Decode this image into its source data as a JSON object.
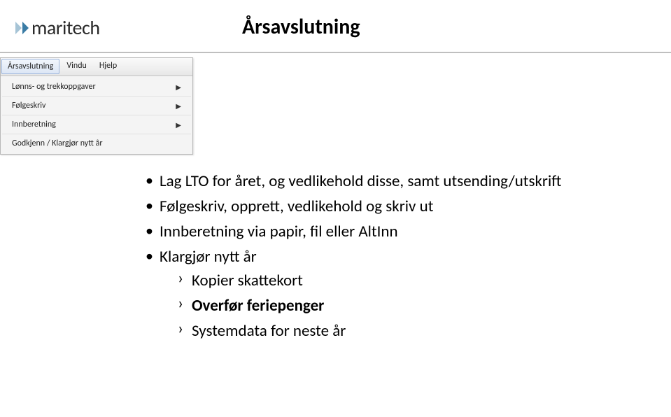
{
  "logo_text": "maritech",
  "page_title": "Årsavslutning",
  "menubar": {
    "items": [
      {
        "label": "Årsavslutning"
      },
      {
        "label": "Vindu"
      },
      {
        "label": "Hjelp"
      }
    ]
  },
  "dropdown": {
    "items": [
      {
        "label": "Lønns- og trekkoppgaver",
        "has_submenu": true
      },
      {
        "label": "Følgeskriv",
        "has_submenu": true
      },
      {
        "label": "Innberetning",
        "has_submenu": true
      },
      {
        "label": "Godkjenn / Klargjør nytt år",
        "has_submenu": false
      }
    ]
  },
  "bullets": {
    "b1": "Lag LTO for året, og vedlikehold disse, samt utsending/utskrift",
    "b2": "Følgeskriv, opprett, vedlikehold og skriv ut",
    "b3": "Innberetning via papir, fil eller AltInn",
    "b4": "Klargjør nytt år",
    "sub1": "Kopier skattekort",
    "sub2": "Overfør feriepenger",
    "sub3": "Systemdata for neste år"
  }
}
